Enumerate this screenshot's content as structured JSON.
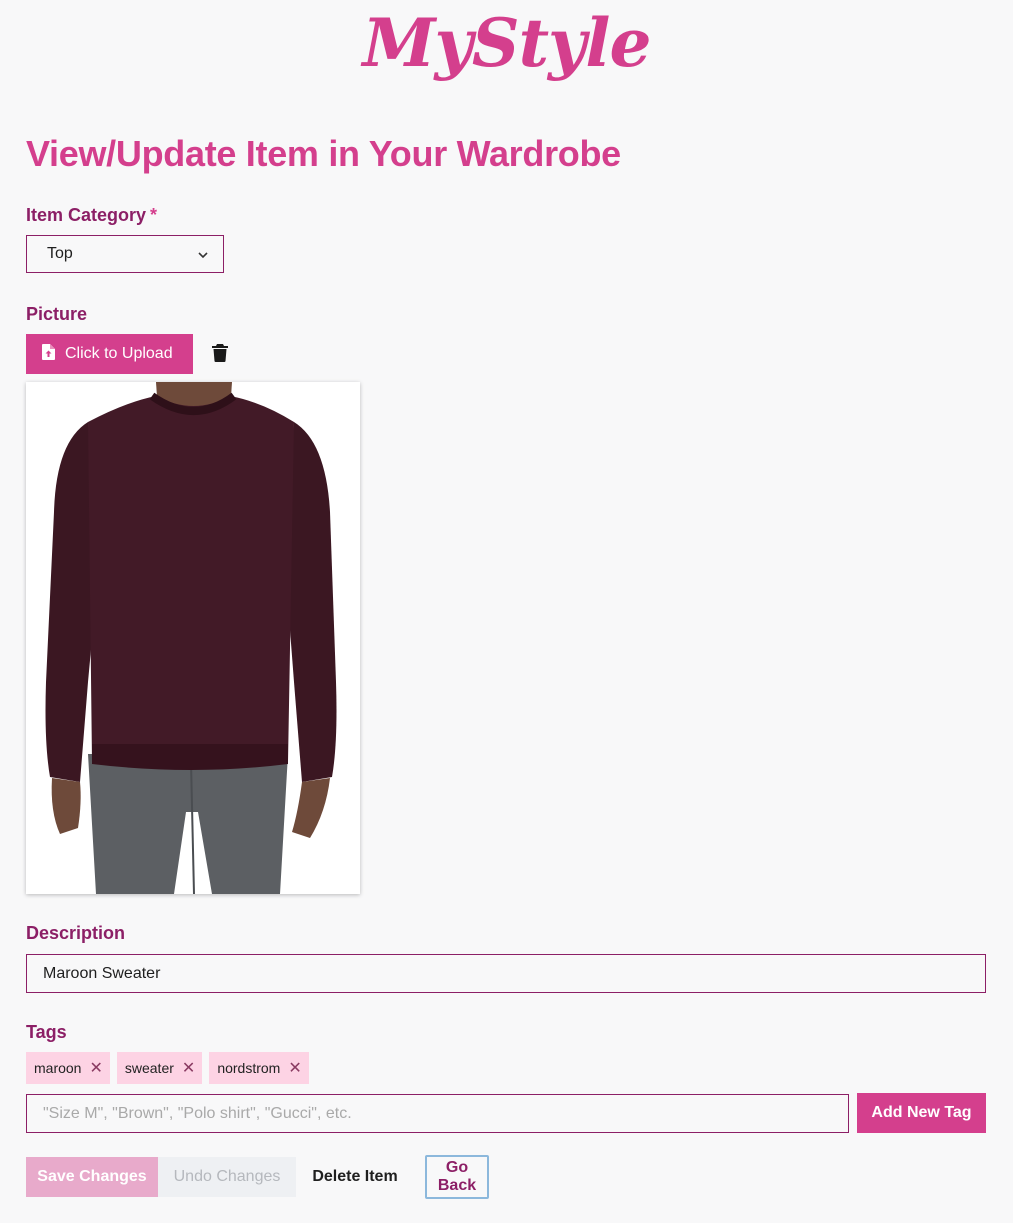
{
  "app": {
    "logo": "MyStyle"
  },
  "page": {
    "title": "View/Update Item in Your Wardrobe"
  },
  "category": {
    "label": "Item Category",
    "required_mark": "*",
    "selected": "Top"
  },
  "picture": {
    "label": "Picture",
    "upload_label": "Click to Upload",
    "photo_subject": "maroon crew-neck sweater on model with grey jeans"
  },
  "description": {
    "label": "Description",
    "value": "Maroon Sweater"
  },
  "tags": {
    "label": "Tags",
    "items": [
      {
        "label": "maroon"
      },
      {
        "label": "sweater"
      },
      {
        "label": "nordstrom"
      }
    ],
    "input_placeholder": "\"Size M\", \"Brown\", \"Polo shirt\", \"Gucci\", etc.",
    "add_label": "Add New Tag"
  },
  "actions": {
    "save": "Save Changes",
    "undo": "Undo Changes",
    "delete": "Delete Item",
    "back": "Go Back"
  },
  "colors": {
    "accent": "#d43f8d",
    "label": "#8c1f66",
    "tag_bg": "#fdd3e4",
    "background": "#f8f8f9"
  }
}
